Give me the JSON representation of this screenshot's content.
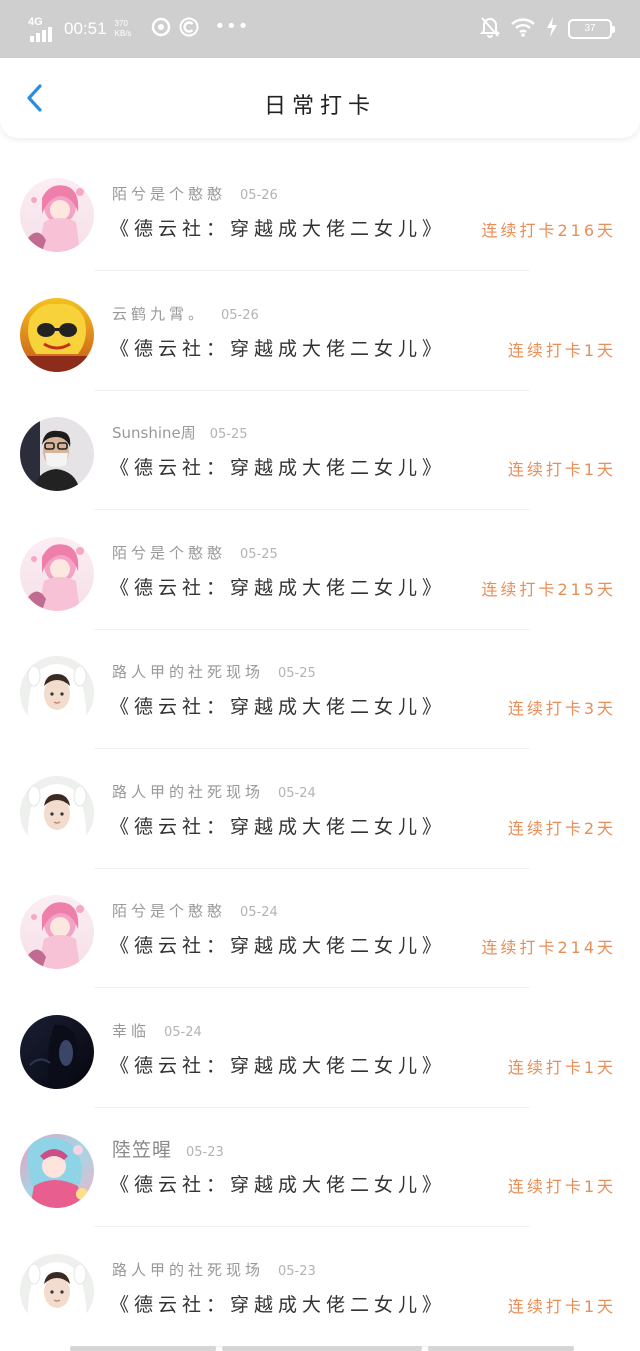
{
  "status_bar": {
    "network": "4G",
    "time": "00:51",
    "speed_value": "370",
    "speed_unit": "KB/s",
    "battery": "37",
    "icons": [
      "signal-icon",
      "app-icon-netease",
      "app-icon-c",
      "more-dots-icon",
      "mute-icon",
      "wifi-icon",
      "charging-icon",
      "battery-icon"
    ]
  },
  "header": {
    "title": "日常打卡",
    "back_icon": "chevron-left-icon",
    "accent_color": "#2a8ee0"
  },
  "colors": {
    "streak": "#e88e57",
    "name": "#999999",
    "book": "#333333"
  },
  "entries": [
    {
      "user": "陌兮是个憨憨",
      "date": "05-26",
      "book": "《德云社：穿越成大佬二女儿》",
      "streak": "连续打卡216天",
      "avatar": "anime-pink-hair-avatar"
    },
    {
      "user": "云鹤九霄。",
      "date": "05-26",
      "book": "《德云社：穿越成大佬二女儿》",
      "streak": "连续打卡1天",
      "avatar": "lion-dance-avatar"
    },
    {
      "user": "Sunshine周",
      "date": "05-25",
      "book": "《德云社：穿越成大佬二女儿》",
      "streak": "连续打卡1天",
      "avatar": "masked-boy-avatar"
    },
    {
      "user": "陌兮是个憨憨",
      "date": "05-25",
      "book": "《德云社：穿越成大佬二女儿》",
      "streak": "连续打卡215天",
      "avatar": "anime-pink-hair-avatar"
    },
    {
      "user": "路人甲的社死现场",
      "date": "05-25",
      "book": "《德云社：穿越成大佬二女儿》",
      "streak": "连续打卡3天",
      "avatar": "boy-white-hood-avatar"
    },
    {
      "user": "路人甲的社死现场",
      "date": "05-24",
      "book": "《德云社：穿越成大佬二女儿》",
      "streak": "连续打卡2天",
      "avatar": "boy-white-hood-avatar"
    },
    {
      "user": "陌兮是个憨憨",
      "date": "05-24",
      "book": "《德云社：穿越成大佬二女儿》",
      "streak": "连续打卡214天",
      "avatar": "anime-pink-hair-avatar"
    },
    {
      "user": "幸临",
      "date": "05-24",
      "book": "《德云社：穿越成大佬二女儿》",
      "streak": "连续打卡1天",
      "avatar": "dark-portrait-avatar"
    },
    {
      "user": "陸笠暒",
      "date": "05-23",
      "book": "《德云社：穿越成大佬二女儿》",
      "streak": "连续打卡1天",
      "avatar": "anime-colorful-avatar"
    },
    {
      "user": "路人甲的社死现场",
      "date": "05-23",
      "book": "《德云社：穿越成大佬二女儿》",
      "streak": "连续打卡1天",
      "avatar": "boy-white-hood-avatar"
    }
  ]
}
